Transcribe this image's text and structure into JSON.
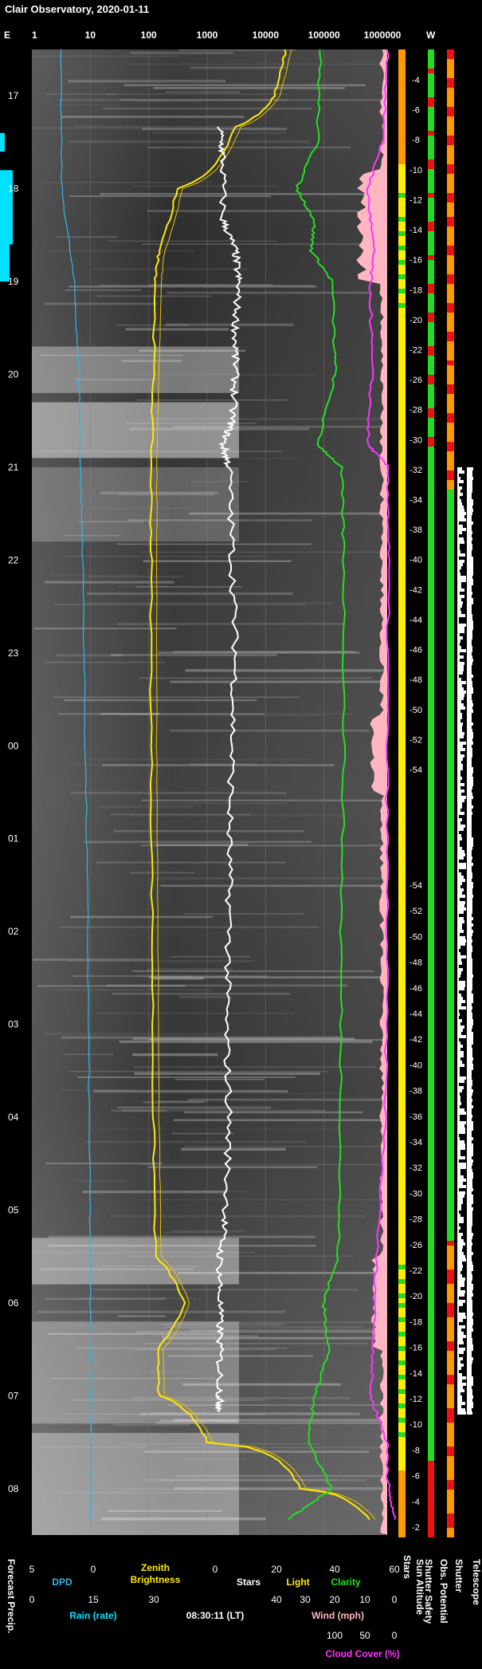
{
  "page": {
    "title": "Clair Observatory, 2020-01-11",
    "corner_left": "E",
    "corner_right": "W"
  },
  "colors": {
    "dpd": "#2fb8e8",
    "rain": "#00e0ff",
    "zenith": "#ffea00",
    "stars": "#ffffff",
    "clarity": "#22e022",
    "cloud": "#ff33ff",
    "wind": "#ffb6c1",
    "sun": "#ffee00",
    "ok": "#22dd22",
    "warn": "#ff9900",
    "bad": "#ee1111"
  },
  "labels": {
    "top_axis": [
      "1",
      "10",
      "100",
      "1000",
      "10000",
      "100000",
      "1000000"
    ],
    "time_ticks": [
      "17",
      "18",
      "19",
      "20",
      "21",
      "22",
      "23",
      "00",
      "01",
      "02",
      "03",
      "04",
      "05",
      "06",
      "07",
      "08"
    ],
    "right_ticks_upper": [
      "-4",
      "-6",
      "-8",
      "-10",
      "-12",
      "-14",
      "-16",
      "-18",
      "-20",
      "-22",
      "-26",
      "-28",
      "-30",
      "-32",
      "-34",
      "-38",
      "-40",
      "-42",
      "-44",
      "-46",
      "-48",
      "-50",
      "-52",
      "-54"
    ],
    "right_ticks_lower": [
      "-54",
      "-52",
      "-50",
      "-48",
      "-46",
      "-44",
      "-42",
      "-40",
      "-38",
      "-36",
      "-34",
      "-32",
      "-30",
      "-28",
      "-26",
      "-22",
      "-20",
      "-18",
      "-16",
      "-14",
      "-12",
      "-10",
      "-8",
      "-6",
      "-4",
      "-2"
    ],
    "vertical_labels": [
      "Forecast Precip.",
      "Sun Altitude",
      "Shutter Safety",
      "Obs. Potential",
      "Shutter",
      "Telescope"
    ],
    "stars_label": "Stars",
    "bottom_row1": {
      "ticks": [
        "5",
        "0",
        "0",
        "20",
        "40",
        "60"
      ],
      "dpd": "DPD",
      "zenith1": "Zenith",
      "zenith2": "Brightness",
      "stars": "Stars",
      "light": "Light",
      "clarity": "Clarity"
    },
    "bottom_row2": {
      "ticks": [
        "0",
        "15",
        "30",
        "40",
        "30",
        "20",
        "10",
        "0"
      ],
      "rain": "Rain (rate)",
      "time": "08:30:11 (LT)",
      "wind": "Wind (mph)"
    },
    "bottom_row3": {
      "ticks": [
        "100",
        "50",
        "0"
      ],
      "cloud": "Cloud Cover (%)"
    }
  },
  "chart_data": {
    "type": "line",
    "x_axis": "time (local)",
    "time_range": [
      "16:30",
      "08:30"
    ],
    "series": [
      {
        "name": "DPD",
        "x": [
          "16:30",
          "18:00",
          "19:00",
          "20:00",
          "21:00",
          "22:00",
          "00:00",
          "02:00",
          "04:00",
          "05:30",
          "06:30",
          "07:30",
          "08:20"
        ],
        "values": [
          2.7,
          2.6,
          1.6,
          1.2,
          1.1,
          0.9,
          0.7,
          0.5,
          0.4,
          0.3,
          0.3,
          0.2,
          0.3
        ]
      },
      {
        "name": "Zenith Brightness",
        "x": [
          "16:30",
          "17:00",
          "17:20",
          "18:00",
          "18:40",
          "19:00",
          "20:00",
          "21:00",
          "22:00",
          "00:00",
          "02:00",
          "04:00",
          "05:30",
          "06:00",
          "06:30",
          "07:00",
          "07:30",
          "08:00",
          "08:20"
        ],
        "values": [
          22000,
          14000,
          3000,
          300,
          150,
          130,
          120,
          110,
          110,
          110,
          115,
          120,
          130,
          400,
          140,
          150,
          1000,
          40000,
          600000
        ]
      },
      {
        "name": "Stars",
        "x": [
          "17:20",
          "17:40",
          "18:20",
          "18:40",
          "19:00",
          "19:30",
          "20:00",
          "20:30",
          "20:45",
          "21:00",
          "22:00",
          "23:00",
          "00:00",
          "01:00",
          "02:00",
          "03:00",
          "04:00",
          "05:00",
          "05:30",
          "06:00",
          "06:30",
          "07:00",
          "07:10"
        ],
        "values": [
          1,
          2,
          2,
          6,
          7,
          6,
          6,
          5,
          2,
          4,
          5,
          6,
          5,
          4,
          4,
          3,
          4,
          3,
          1,
          1,
          1,
          1,
          1
        ]
      },
      {
        "name": "Clarity",
        "x": [
          "16:30",
          "17:30",
          "18:00",
          "18:20",
          "18:40",
          "19:00",
          "20:00",
          "20:45",
          "21:00",
          "22:00",
          "00:00",
          "02:00",
          "04:00",
          "05:30",
          "06:00",
          "06:30",
          "07:00",
          "07:30",
          "08:00",
          "08:20"
        ],
        "values": [
          35,
          34,
          27,
          33,
          32,
          39,
          40,
          34,
          42,
          43,
          43,
          42,
          42,
          41,
          36,
          38,
          33,
          31,
          39,
          24
        ]
      },
      {
        "name": "Cloud Cover",
        "x": [
          "16:30",
          "17:30",
          "18:00",
          "18:40",
          "19:00",
          "20:00",
          "20:45",
          "21:00",
          "22:00",
          "00:00",
          "02:00",
          "04:00",
          "05:30",
          "06:30",
          "07:00",
          "07:30",
          "08:00",
          "08:20"
        ],
        "values": [
          10,
          20,
          45,
          35,
          40,
          38,
          45,
          10,
          10,
          12,
          12,
          15,
          30,
          35,
          40,
          12,
          10,
          0
        ]
      }
    ],
    "sun_altitude": {
      "upper": [
        -4,
        -6,
        -8,
        -10,
        -12,
        -14,
        -16,
        -18,
        -20,
        -22,
        -26,
        -28,
        -30,
        -32,
        -34,
        -38,
        -40,
        -42,
        -44,
        -46,
        -48,
        -50,
        -52,
        -54
      ],
      "lower": [
        -54,
        -52,
        -50,
        -48,
        -46,
        -44,
        -42,
        -40,
        -38,
        -36,
        -34,
        -32,
        -30,
        -28,
        -26,
        -22,
        -20,
        -18,
        -16,
        -14,
        -12,
        -10,
        -8,
        -6,
        -4,
        -2
      ]
    },
    "ylim_clarity": [
      0,
      60
    ],
    "ylim_zenith_log": [
      1,
      1000000
    ]
  }
}
